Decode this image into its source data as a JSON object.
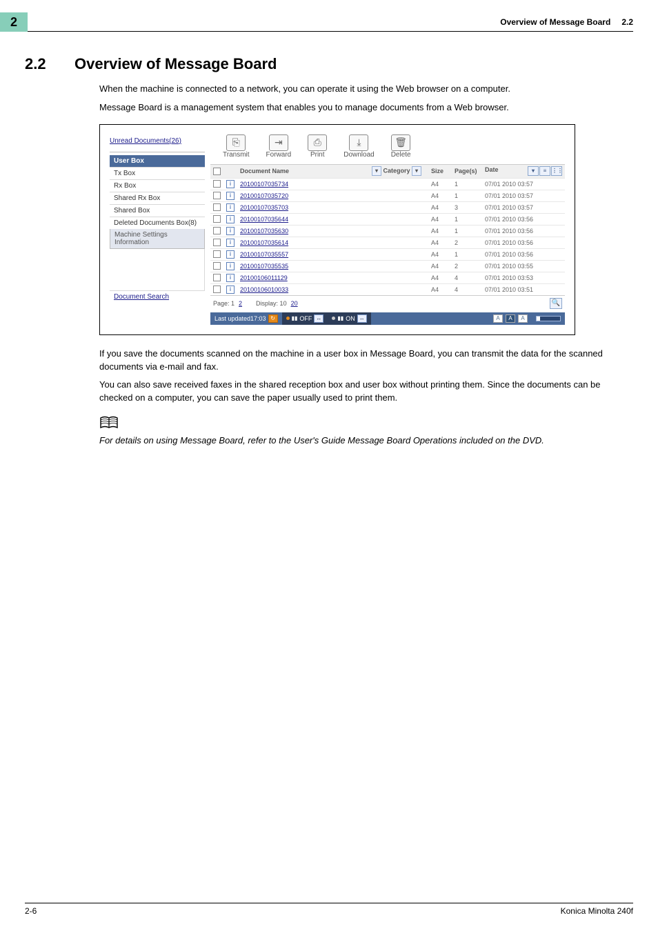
{
  "page_tab_number": "2",
  "header": {
    "title": "Overview of Message Board",
    "section_ref": "2.2"
  },
  "section": {
    "number": "2.2",
    "title": "Overview of Message Board"
  },
  "intro_para_1": "When the machine is connected to a network, you can operate it using the Web browser on a computer.",
  "intro_para_2": "Message Board is a management system that enables you to manage documents from a Web browser.",
  "after_para_1": "If you save the documents scanned on the machine in a user box in Message Board, you can transmit the data for the scanned documents via e-mail and fax.",
  "after_para_2": "You can also save received faxes in the shared reception box and user box without printing them. Since the documents can be checked on a computer, you can save the paper usually used to print them.",
  "note_para": "For details on using Message Board, refer to the User's Guide Message Board Operations included on the DVD.",
  "screenshot": {
    "left": {
      "unread_label": "Unread Documents(26)",
      "active_tab": "User Box",
      "items": [
        "Tx Box",
        "Rx Box",
        "Shared Rx Box",
        "Shared Box",
        "Deleted Documents Box(8)"
      ],
      "machine_tab": "Machine Settings Information",
      "search_link": "Document Search"
    },
    "toolbar": [
      {
        "icon": "⎘",
        "label": "Transmit"
      },
      {
        "icon": "⇥",
        "label": "Forward"
      },
      {
        "icon": "⎙",
        "label": "Print"
      },
      {
        "icon": "⤓",
        "label": "Download"
      },
      {
        "icon": "🗑",
        "label": "Delete"
      }
    ],
    "table_headers": {
      "doc_name": "Document Name",
      "category": "Category",
      "size": "Size",
      "pages": "Page(s)",
      "date": "Date"
    },
    "rows": [
      {
        "doc": "20100107035734",
        "size": "A4",
        "pages": "1",
        "date": "07/01 2010 03:57"
      },
      {
        "doc": "20100107035720",
        "size": "A4",
        "pages": "1",
        "date": "07/01 2010 03:57"
      },
      {
        "doc": "20100107035703",
        "size": "A4",
        "pages": "3",
        "date": "07/01 2010 03:57"
      },
      {
        "doc": "20100107035644",
        "size": "A4",
        "pages": "1",
        "date": "07/01 2010 03:56"
      },
      {
        "doc": "20100107035630",
        "size": "A4",
        "pages": "1",
        "date": "07/01 2010 03:56"
      },
      {
        "doc": "20100107035614",
        "size": "A4",
        "pages": "2",
        "date": "07/01 2010 03:56"
      },
      {
        "doc": "20100107035557",
        "size": "A4",
        "pages": "1",
        "date": "07/01 2010 03:56"
      },
      {
        "doc": "20100107035535",
        "size": "A4",
        "pages": "2",
        "date": "07/01 2010 03:55"
      },
      {
        "doc": "20100106011129",
        "size": "A4",
        "pages": "4",
        "date": "07/01 2010 03:53"
      },
      {
        "doc": "20100106010033",
        "size": "A4",
        "pages": "4",
        "date": "07/01 2010 03:51"
      }
    ],
    "pager": {
      "page_label": "Page: 1",
      "page2": "2",
      "display_label": "Display: 10",
      "display20": "20"
    },
    "status": {
      "updated": "Last updated17:03",
      "off": "OFF",
      "on": "ON",
      "a": "A"
    }
  },
  "footer": {
    "left": "2-6",
    "right": "Konica Minolta 240f"
  }
}
